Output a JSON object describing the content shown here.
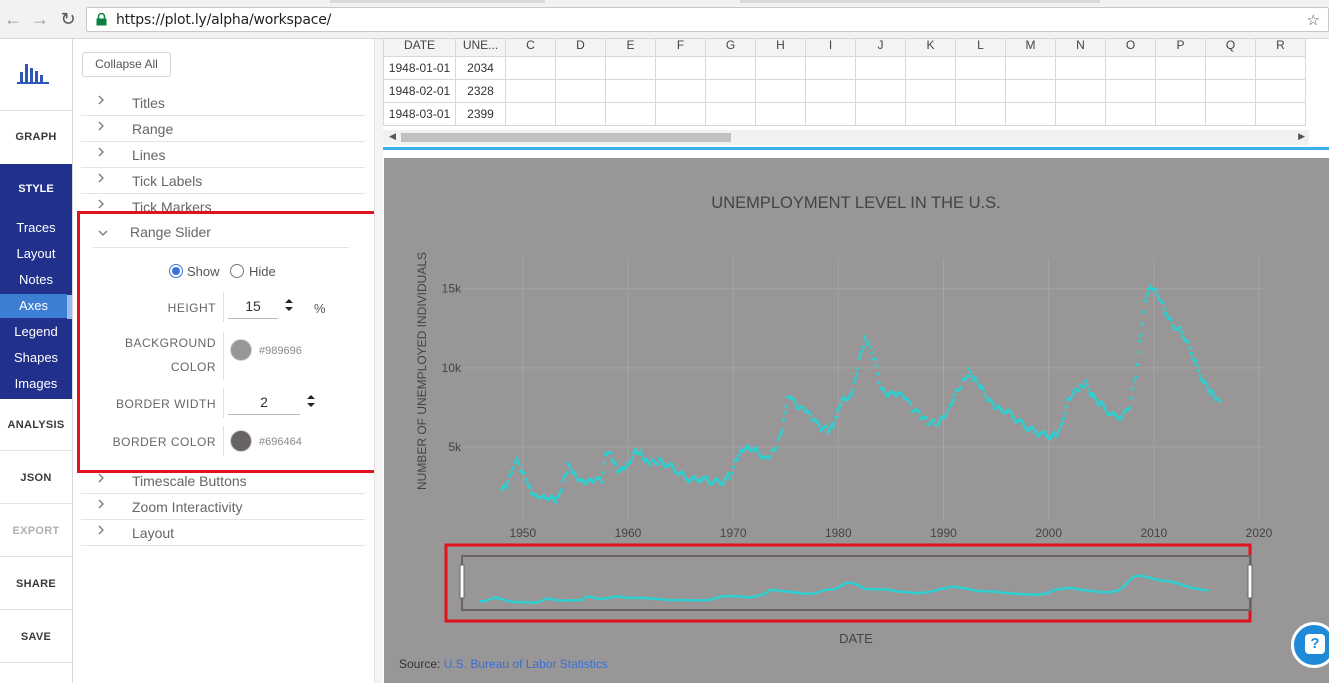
{
  "browser": {
    "url": "https://plot.ly/alpha/workspace/"
  },
  "leftnav": {
    "graph": "GRAPH",
    "style": "STYLE",
    "style_items": [
      "Traces",
      "Layout",
      "Notes",
      "Axes",
      "Legend",
      "Shapes",
      "Images"
    ],
    "active_item": "Axes",
    "analysis": "ANALYSIS",
    "json": "JSON",
    "export": "EXPORT",
    "share": "SHARE",
    "save": "SAVE"
  },
  "panel": {
    "collapse_all": "Collapse All",
    "sections_top": [
      "Titles",
      "Range",
      "Lines",
      "Tick Labels",
      "Tick Markers"
    ],
    "range_slider": {
      "title": "Range Slider",
      "show_label": "Show",
      "hide_label": "Hide",
      "selected": "Show",
      "height_label": "HEIGHT",
      "height_value": "15",
      "height_unit": "%",
      "bg_label_1": "BACKGROUND",
      "bg_label_2": "COLOR",
      "bg_color": "#989696",
      "border_width_label": "BORDER WIDTH",
      "border_width_value": "2",
      "border_color_label": "BORDER COLOR",
      "border_color": "#696464"
    },
    "sections_bottom": [
      "Timescale Buttons",
      "Zoom Interactivity",
      "Layout"
    ]
  },
  "grid": {
    "columns": [
      "DATE",
      "UNE...",
      "C",
      "D",
      "E",
      "F",
      "G",
      "H",
      "I",
      "J",
      "K",
      "L",
      "M",
      "N",
      "O",
      "P",
      "Q",
      "R"
    ],
    "rows": [
      [
        "1948-01-01",
        "2034"
      ],
      [
        "1948-02-01",
        "2328"
      ],
      [
        "1948-03-01",
        "2399"
      ]
    ]
  },
  "chart_data": {
    "type": "scatter",
    "title": "UNEMPLOYMENT LEVEL IN THE U.S.",
    "xlabel": "DATE",
    "ylabel": "NUMBER OF UNEMPLOYED INDIVIDUALS",
    "source_prefix": "Source: ",
    "source_link": "U.S. Bureau of Labor Statistics",
    "x_ticks": [
      "1950",
      "1960",
      "1970",
      "1980",
      "1990",
      "2000",
      "2010",
      "2020"
    ],
    "y_ticks": [
      "5k",
      "10k",
      "15k"
    ],
    "xlim": [
      1946.5,
      2020
    ],
    "ylim": [
      700,
      16500
    ],
    "grid": true,
    "marker_color": "#2ecfd1",
    "range_slider": {
      "visible": true,
      "bgcolor": "#989696",
      "bordercolor": "#696464",
      "borderwidth": 2
    },
    "series": [
      {
        "x": [
          1948.0,
          1948.5,
          1949.0,
          1949.5,
          1949.8,
          1950.3,
          1950.8,
          1951.3,
          1952.0,
          1952.8,
          1953.3,
          1953.8,
          1954.3,
          1954.8,
          1955.3,
          1956.0,
          1956.8,
          1957.5,
          1958.0,
          1958.5,
          1959.0,
          1959.5,
          1960.0,
          1960.7,
          1961.2,
          1961.7,
          1962.3,
          1963.0,
          1964.0,
          1965.0,
          1966.0,
          1967.0,
          1968.0,
          1969.0,
          1969.7,
          1970.3,
          1970.8,
          1971.5,
          1972.3,
          1973.0,
          1973.7,
          1974.3,
          1974.8,
          1975.2,
          1975.6,
          1976.2,
          1976.8,
          1977.5,
          1978.3,
          1979.0,
          1979.5,
          1980.0,
          1980.5,
          1981.0,
          1981.5,
          1982.0,
          1982.5,
          1982.9,
          1983.5,
          1984.0,
          1984.8,
          1985.5,
          1986.3,
          1987.0,
          1987.8,
          1988.5,
          1989.3,
          1990.0,
          1990.6,
          1991.2,
          1991.8,
          1992.4,
          1993.0,
          1993.6,
          1994.3,
          1995.0,
          1996.0,
          1997.0,
          1998.0,
          1999.0,
          2000.0,
          2000.7,
          2001.3,
          2001.8,
          2002.5,
          2003.0,
          2003.5,
          2004.2,
          2005.0,
          2006.0,
          2007.0,
          2007.7,
          2008.3,
          2008.8,
          2009.3,
          2009.8,
          2010.3,
          2011.0,
          2011.8,
          2012.5,
          2013.3,
          2014.0,
          2014.8,
          2015.5,
          2016.0,
          2016.3
        ],
        "y": [
          2300,
          2500,
          3500,
          4300,
          3700,
          3100,
          2200,
          2000,
          1900,
          1800,
          1650,
          2700,
          3800,
          3300,
          2800,
          2700,
          2900,
          2900,
          4800,
          4400,
          3600,
          3700,
          4000,
          4800,
          4700,
          4100,
          4000,
          4100,
          3800,
          3300,
          2900,
          3000,
          2800,
          2800,
          3200,
          4300,
          4900,
          5000,
          4800,
          4300,
          4600,
          5300,
          6500,
          8000,
          8000,
          7400,
          7300,
          6800,
          6200,
          6100,
          6400,
          7500,
          8200,
          8100,
          9000,
          10500,
          11800,
          11400,
          10400,
          8600,
          8300,
          8300,
          8200,
          7400,
          7000,
          6600,
          6500,
          6900,
          7600,
          8500,
          9100,
          9800,
          9200,
          8700,
          7900,
          7400,
          7300,
          6700,
          6200,
          5900,
          5700,
          5800,
          6600,
          8000,
          8600,
          8800,
          9000,
          8200,
          7700,
          7000,
          6900,
          7500,
          9500,
          12200,
          14700,
          15200,
          14800,
          13800,
          12700,
          12500,
          11500,
          10300,
          9000,
          8400,
          7900,
          7900
        ]
      }
    ]
  }
}
